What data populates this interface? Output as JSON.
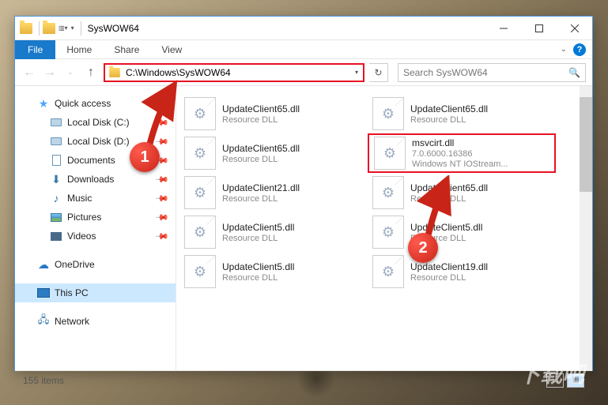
{
  "window": {
    "title": "SysWOW64"
  },
  "ribbon": {
    "file": "File",
    "tabs": [
      "Home",
      "Share",
      "View"
    ]
  },
  "address": {
    "path": "C:\\Windows\\SysWOW64"
  },
  "search": {
    "placeholder": "Search SysWOW64"
  },
  "nav": {
    "quick": "Quick access",
    "items": [
      {
        "label": "Local Disk (C:)",
        "icon": "disk",
        "pin": true
      },
      {
        "label": "Local Disk (D:)",
        "icon": "disk",
        "pin": true
      },
      {
        "label": "Documents",
        "icon": "doc",
        "pin": true
      },
      {
        "label": "Downloads",
        "icon": "dl",
        "pin": true
      },
      {
        "label": "Music",
        "icon": "music",
        "pin": true
      },
      {
        "label": "Pictures",
        "icon": "pic",
        "pin": true
      },
      {
        "label": "Videos",
        "icon": "vid",
        "pin": true
      }
    ],
    "onedrive": "OneDrive",
    "thispc": "This PC",
    "network": "Network"
  },
  "files": [
    {
      "name": "UpdateClient65.dll",
      "line2": "Resource DLL",
      "line3": ""
    },
    {
      "name": "UpdateClient65.dll",
      "line2": "Resource DLL",
      "line3": ""
    },
    {
      "name": "UpdateClient65.dll",
      "line2": "Resource DLL",
      "line3": ""
    },
    {
      "name": "msvcirt.dll",
      "line2": "7.0.6000.16386",
      "line3": "Windows NT IOStream...",
      "hl": true
    },
    {
      "name": "UpdateClient21.dll",
      "line2": "Resource DLL",
      "line3": ""
    },
    {
      "name": "UpdateClient65.dll",
      "line2": "Resource DLL",
      "line3": ""
    },
    {
      "name": "UpdateClient5.dll",
      "line2": "Resource DLL",
      "line3": ""
    },
    {
      "name": "UpdateClient5.dll",
      "line2": "Resource DLL",
      "line3": ""
    },
    {
      "name": "UpdateClient5.dll",
      "line2": "Resource DLL",
      "line3": ""
    },
    {
      "name": "UpdateClient19.dll",
      "line2": "Resource DLL",
      "line3": ""
    }
  ],
  "status": {
    "count": "155 items"
  },
  "markers": {
    "one": "1",
    "two": "2"
  }
}
